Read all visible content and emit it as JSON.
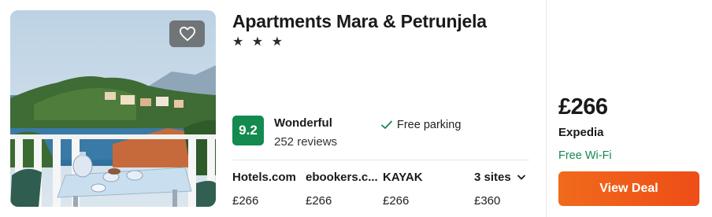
{
  "hotel": {
    "name": "Apartments Mara & Petrunjela",
    "stars": "★ ★ ★"
  },
  "rating": {
    "score": "9.2",
    "word": "Wonderful",
    "reviews": "252 reviews"
  },
  "amenities": [
    {
      "label": "Free parking",
      "icon": "check-icon"
    }
  ],
  "sites": [
    {
      "name": "Hotels.com",
      "price": "£266"
    },
    {
      "name": "ebookers.c...",
      "price": "£266"
    },
    {
      "name": "KAYAK",
      "price": "£266"
    }
  ],
  "more_sites": {
    "label": "3 sites",
    "price": "£360",
    "icon": "chevron-down-icon"
  },
  "deal": {
    "price": "£266",
    "provider": "Expedia",
    "perk": "Free Wi-Fi",
    "button_label": "View Deal"
  },
  "colors": {
    "rating_green": "#138a4f",
    "deal_orange": "#f06a1c",
    "perk_green": "#138a4f"
  }
}
